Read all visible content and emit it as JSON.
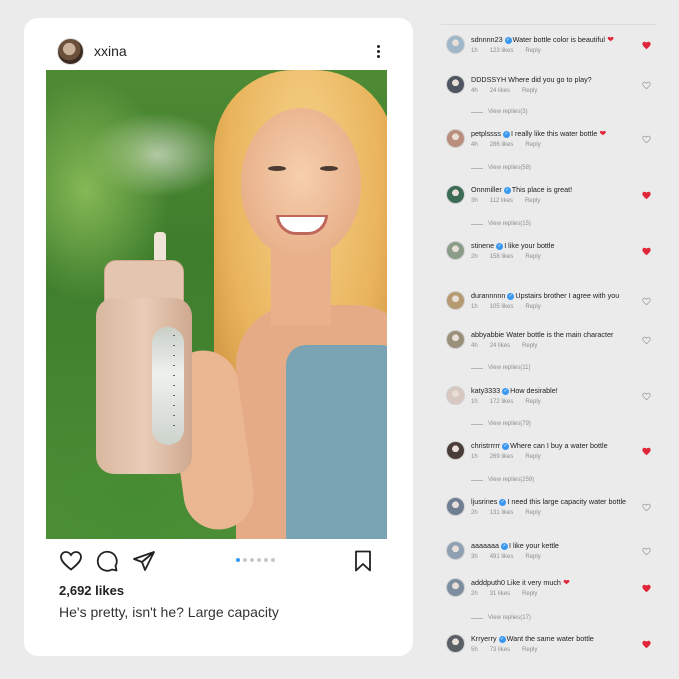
{
  "post": {
    "username": "xxina",
    "likes": "2,692 likes",
    "caption": "He's pretty, isn't he? Large capacity"
  },
  "carousel": {
    "count": 6,
    "active_index": 0
  },
  "colors": {
    "accent": "#3897f0",
    "heart_red": "#e0263a",
    "meta_gray": "#8e8e8e"
  },
  "comments": [
    {
      "user": "sdnnnn23",
      "verified": true,
      "text": "Water bottle color is beautiful",
      "emoji": "❤",
      "time": "1h",
      "likes": "123 likes",
      "reply": "Reply",
      "liked": true,
      "replies": null
    },
    {
      "user": "DDDSSYH",
      "verified": false,
      "text": "Where did you go to play?",
      "emoji": "",
      "time": "4h",
      "likes": "24 likes",
      "reply": "Reply",
      "liked": false,
      "replies": "View replies(3)"
    },
    {
      "user": "petplssss",
      "verified": true,
      "text": "I really like this water bottle",
      "emoji": "❤",
      "time": "4h",
      "likes": "286 likes",
      "reply": "Reply",
      "liked": false,
      "replies": "View replies(58)"
    },
    {
      "user": "Onnmiller",
      "verified": true,
      "text": "This place is great!",
      "emoji": "",
      "time": "3h",
      "likes": "112 likes",
      "reply": "Reply",
      "liked": true,
      "replies": "View replies(15)"
    },
    {
      "user": "stinene",
      "verified": true,
      "text": "I like your bottle",
      "emoji": "",
      "time": "2h",
      "likes": "158 likes",
      "reply": "Reply",
      "liked": true,
      "replies": null
    },
    {
      "user": "durannnnn",
      "verified": true,
      "text": "Upstairs brother I agree with you",
      "emoji": "",
      "time": "1h",
      "likes": "105 likes",
      "reply": "Reply",
      "liked": false,
      "replies": null
    },
    {
      "user": "abbyabbie",
      "verified": false,
      "text": "Water bottle is the main character",
      "emoji": "",
      "time": "4h",
      "likes": "24 likes",
      "reply": "Reply",
      "liked": false,
      "replies": "View replies(11)"
    },
    {
      "user": "katy3333",
      "verified": true,
      "text": "How desirable!",
      "emoji": "",
      "time": "1h",
      "likes": "172 likes",
      "reply": "Reply",
      "liked": false,
      "replies": "View replies(79)"
    },
    {
      "user": "christrrrrr",
      "verified": true,
      "text": "Where can I buy a water bottle",
      "emoji": "",
      "time": "1h",
      "likes": "269 likes",
      "reply": "Reply",
      "liked": true,
      "replies": "View replies(259)"
    },
    {
      "user": "ljusrines",
      "verified": true,
      "text": "I need this large capacity water bottle",
      "emoji": "",
      "time": "2h",
      "likes": "131 likes",
      "reply": "Reply",
      "liked": false,
      "replies": null
    },
    {
      "user": "aaaaaaa",
      "verified": true,
      "text": "I like your kettle",
      "emoji": "",
      "time": "3h",
      "likes": "491 likes",
      "reply": "Reply",
      "liked": false,
      "replies": null
    },
    {
      "user": "adddputh0",
      "verified": false,
      "text": "Like it very much",
      "emoji": "❤",
      "time": "2h",
      "likes": "31 likes",
      "reply": "Reply",
      "liked": true,
      "replies": "View replies(17)"
    },
    {
      "user": "Krryerry",
      "verified": true,
      "text": "Want the same water bottle",
      "emoji": "",
      "time": "5h",
      "likes": "73 likes",
      "reply": "Reply",
      "liked": true,
      "replies": null
    }
  ]
}
